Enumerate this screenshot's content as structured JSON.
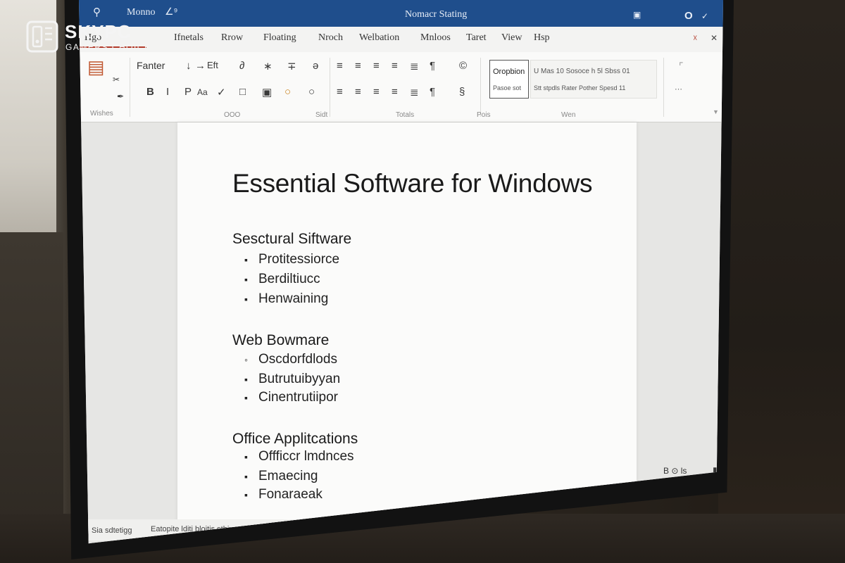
{
  "watermark": {
    "brand": "SKYPC",
    "tagline": "GAMERS CHOICE"
  },
  "titlebar": {
    "search_icon": "search-icon",
    "name_text": "Monno",
    "signature_text": "∠⁹",
    "title": "Nomacr Stating",
    "right_icons": [
      "▣",
      "O",
      "✓"
    ]
  },
  "tabs": [
    {
      "label": "Hgo"
    },
    {
      "label": "Ifnetals"
    },
    {
      "label": "Rrow"
    },
    {
      "label": "Floating"
    },
    {
      "label": "Nroch"
    },
    {
      "label": "Welbation"
    },
    {
      "label": "Mnloos"
    },
    {
      "label": "Taret"
    },
    {
      "label": "View"
    },
    {
      "label": "Hsp"
    }
  ],
  "ribbon": {
    "font_name": "Fanter",
    "left_group_label": "Wishes",
    "row1_icons": [
      "↓",
      "→",
      "Eft",
      "∂",
      "∗",
      "∓",
      "ə"
    ],
    "row2_labels": [
      "B",
      "I",
      "P",
      "Aa",
      "✓",
      "□",
      "▣",
      "○",
      "○"
    ],
    "para_row1": [
      "≡",
      "≡",
      "≡",
      "≡",
      "≣",
      "¶",
      "©"
    ],
    "para_row2": [
      "≡",
      "≡",
      "≡",
      "≡",
      "≣",
      "¶",
      "§"
    ],
    "style_box_line1": "Oropbion",
    "style_box_line2": "Pasoe sot",
    "style_strip_line1": "U Mas 10   Sosoce h 5l   Sbss 01",
    "style_strip_line2": "Stt stpdls   Rater Pother   Spesd 11",
    "group_labels": [
      "OOO",
      "Sidt",
      "Totals",
      "Pois",
      "Wen"
    ],
    "accent_color": "#b23a2a"
  },
  "document": {
    "title": "Essential Software for Windows",
    "sections": [
      {
        "heading": "Sesctural Siftware",
        "items": [
          "Protitessiorce",
          "Berdiltiucc",
          "Henwaining"
        ]
      },
      {
        "heading": "Web Bowmare",
        "items": [
          "Oscdorfdlods",
          "Butrutuibyyan",
          "Cinentrutiipor"
        ]
      },
      {
        "heading": "Office Applitcations",
        "items": [
          "Offficcr lmdnces",
          "Emaecing",
          "Fonaraeak"
        ]
      }
    ],
    "bullet_glyphs": [
      "▪",
      "▪",
      "▪",
      "◦",
      "▪",
      "▪",
      "▪",
      "▪",
      "▪"
    ]
  },
  "status": {
    "right_zoom": "B ⊙ ls",
    "right_icons": "▮   ≡≡≡   —   ▬ ▪ ▪",
    "left_text": "Sia sdtetigg",
    "mid_text": "Eatopite lditi bloitis sthinore"
  },
  "colors": {
    "titlebar": "#1f4e8c",
    "ribbon": "#fafaf9",
    "page": "#fbfbfa"
  }
}
